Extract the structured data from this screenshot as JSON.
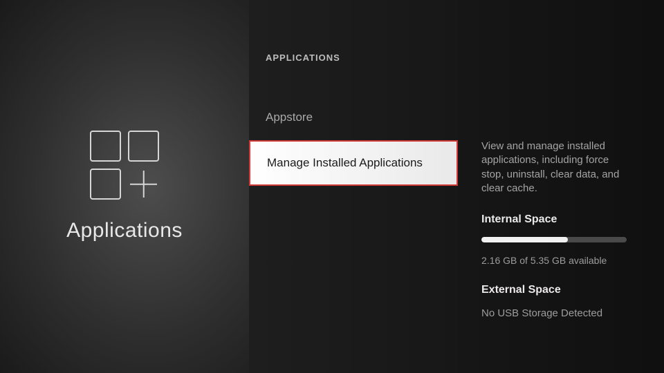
{
  "left": {
    "title": "Applications"
  },
  "middle": {
    "header": "APPLICATIONS",
    "items": [
      {
        "label": "Appstore"
      },
      {
        "label": "Manage Installed Applications"
      }
    ]
  },
  "right": {
    "description": "View and manage installed applications, including force stop, uninstall, clear data, and clear cache.",
    "internal": {
      "heading": "Internal Space",
      "used_gb": 2.16,
      "total_gb": 5.35,
      "availability_text": "2.16 GB of 5.35 GB available",
      "fill_pct": 59.6
    },
    "external": {
      "heading": "External Space",
      "status": "No USB Storage Detected"
    }
  }
}
